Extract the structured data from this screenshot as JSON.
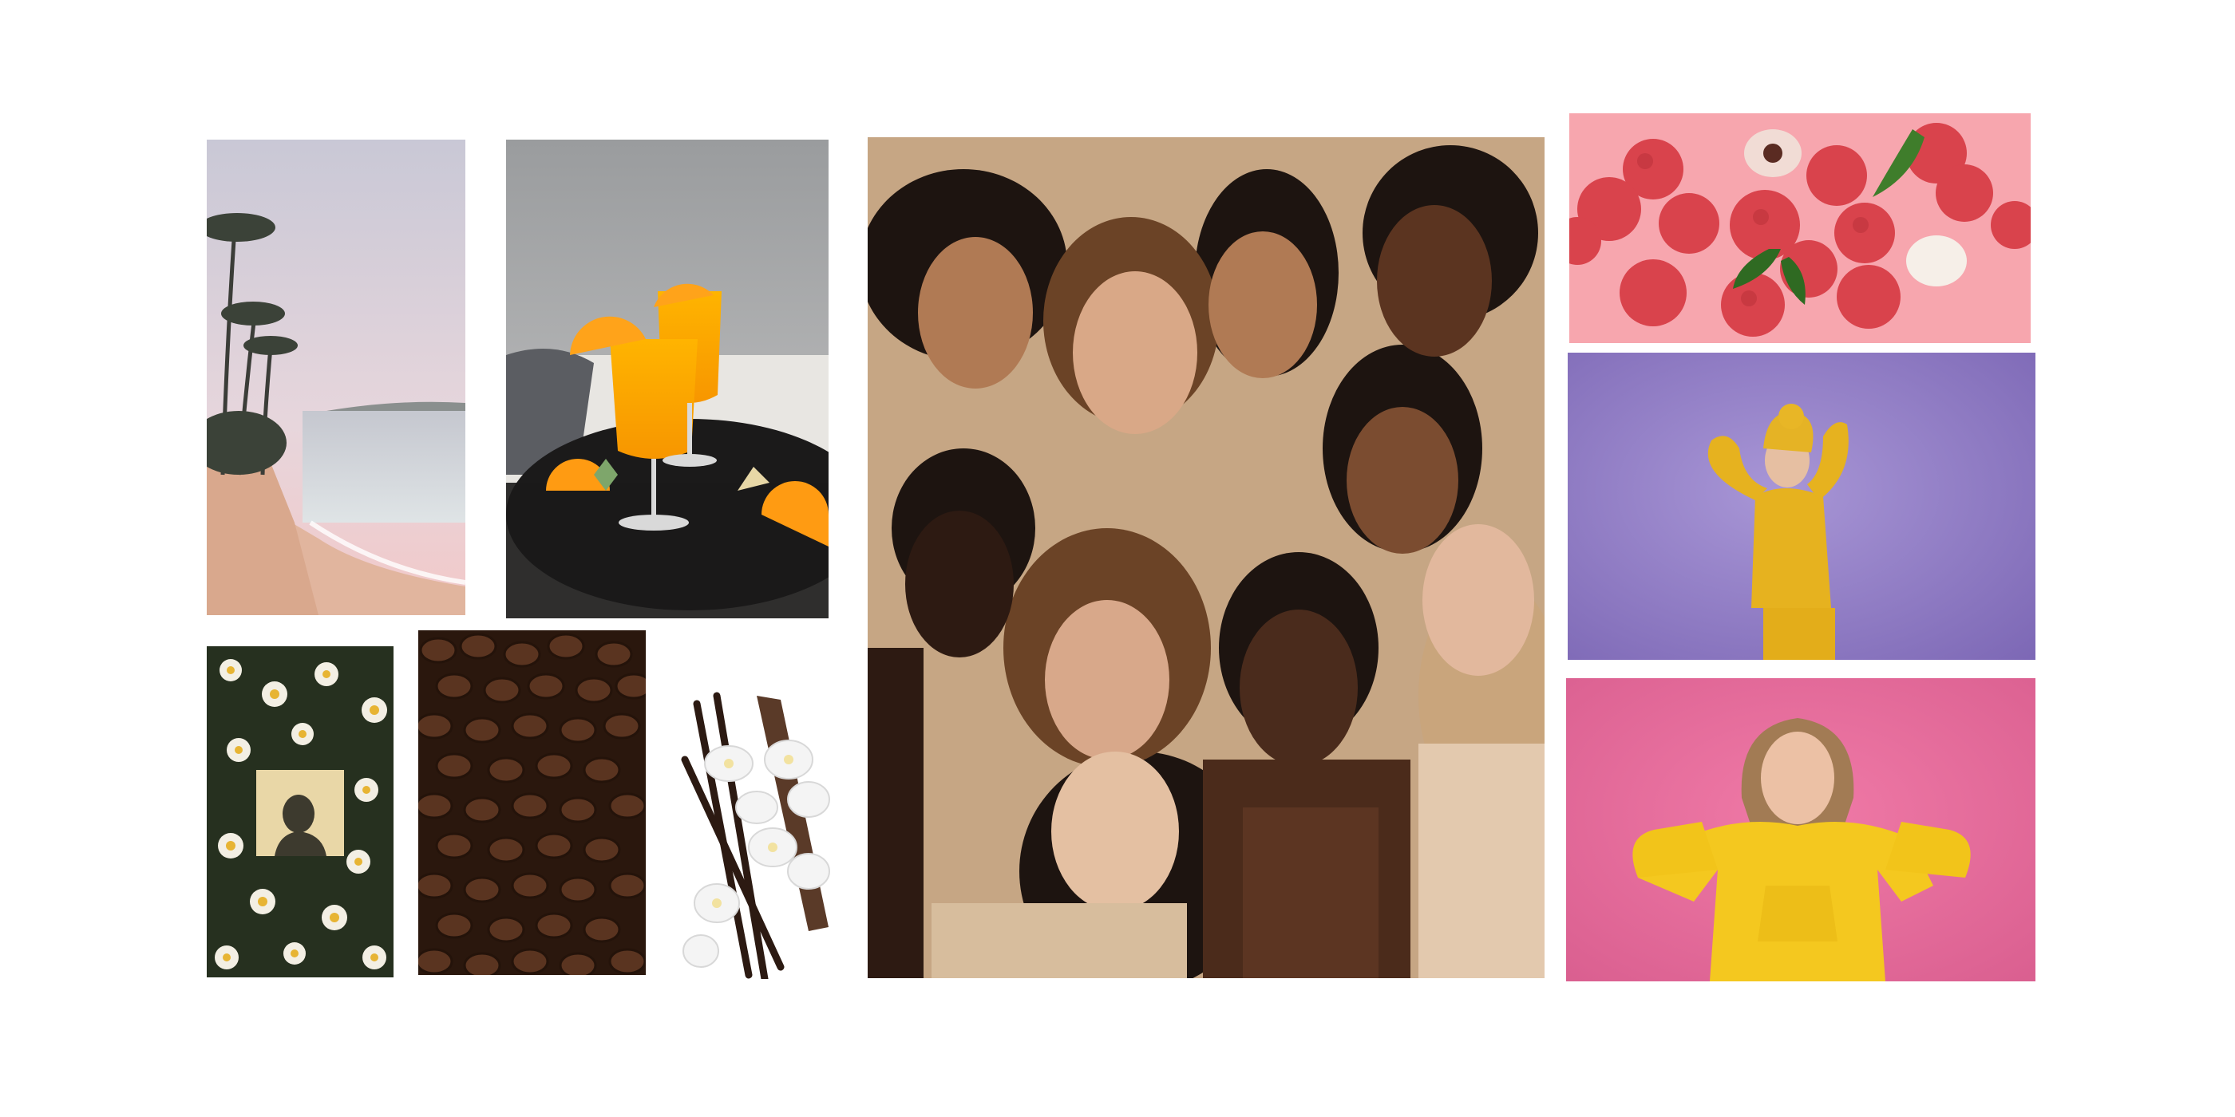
{
  "moodboard": {
    "tiles": [
      {
        "id": "beach",
        "icon": "beach-photo"
      },
      {
        "id": "orange-drinks",
        "icon": "orange-cocktails-photo"
      },
      {
        "id": "group-portrait",
        "icon": "group-portrait-photo"
      },
      {
        "id": "lychees",
        "icon": "lychee-fruit-photo"
      },
      {
        "id": "yellow-beanie",
        "icon": "woman-yellow-beanie-photo"
      },
      {
        "id": "yellow-hoodie",
        "icon": "woman-yellow-hoodie-photo"
      },
      {
        "id": "daisies",
        "icon": "daisy-flowers-photo"
      },
      {
        "id": "coffee",
        "icon": "coffee-beans-photo"
      },
      {
        "id": "vanilla",
        "icon": "vanilla-orchid-photo"
      }
    ]
  }
}
